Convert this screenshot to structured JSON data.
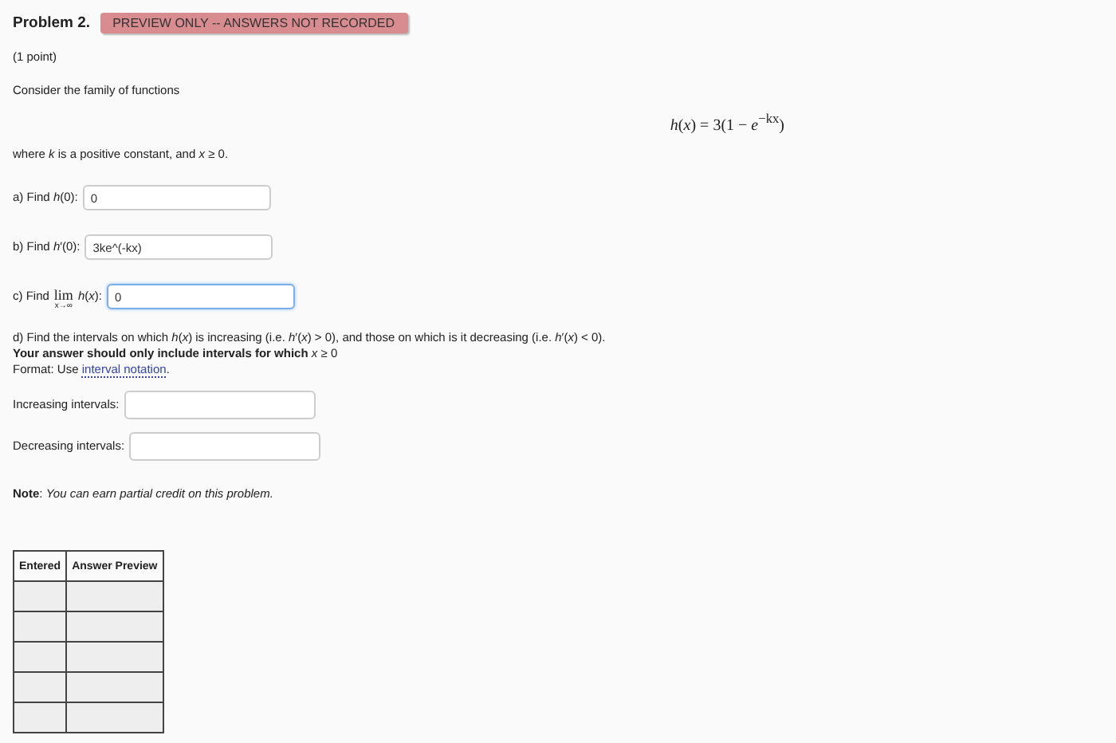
{
  "problem": {
    "title": "Problem 2.",
    "badge": "PREVIEW ONLY -- ANSWERS NOT RECORDED",
    "points": "(1 point)"
  },
  "intro": "Consider the family of functions",
  "formula": "*h*(*x*) = 3(1 − *e*$^{−kx}$)",
  "condition": "where *k* is a positive constant, and *x* ≥ 0.",
  "questions": [
    {
      "kind": "plain",
      "label": "a) Find *h*(0):",
      "value": "0",
      "focused": false
    },
    {
      "kind": "plain",
      "label": "b) Find *h*′(0):",
      "value": "3ke^(-kx)",
      "focused": false
    },
    {
      "kind": "limit",
      "label": "c) Find",
      "limit": "lim",
      "limit_sub": "x→∞",
      "label_after": "*h*(*x*):",
      "value": "0",
      "focused": true
    }
  ],
  "part_d": {
    "text": "d) Find the intervals on which *h*(*x*) is increasing (i.e. *h*′(*x*) > 0), and those on which is it decreasing (i.e. *h*′(*x*) < 0).",
    "emphasis": "**Your answer should only include intervals for which** *x* ≥ 0",
    "format_prefix": "Format: Use",
    "format_link": "interval notation",
    "format_suffix": "."
  },
  "interval_fields": [
    {
      "label": "Increasing intervals:"
    },
    {
      "label": "Decreasing intervals:"
    }
  ],
  "note": "**Note**: *You can earn partial credit on this problem.*",
  "table": {
    "columns": [
      "Entered",
      "Answer Preview"
    ],
    "rows": [
      {
        "kind": "blank"
      },
      {
        "kind": "blank"
      },
      {
        "kind": "blank"
      },
      {
        "kind": "blank"
      },
      {
        "kind": "blank"
      }
    ]
  }
}
